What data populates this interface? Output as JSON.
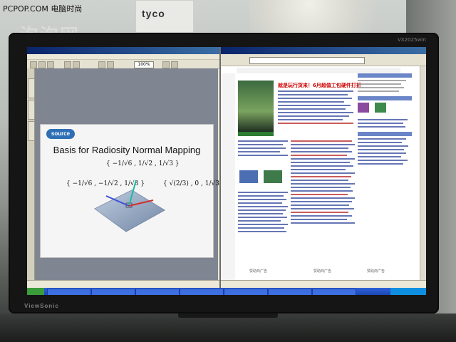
{
  "photo": {
    "site_mark": "PCPOP.COM 电脑时尚",
    "watermark": "泡泡网",
    "box_brand": "tyco"
  },
  "monitor": {
    "brand_bottom": "ViewSonic",
    "brand_top": "VX2025wm"
  },
  "pdf_window": {
    "zoom": "100%",
    "slide": {
      "logo": "source",
      "title": "Basis for Radiosity Normal Mapping",
      "formula_top": "{ −1/√6 , 1/√2 , 1/√3 }",
      "formula_left": "{ −1/√6 , −1/√2 , 1/√3 }",
      "formula_right": "{ √(2/3) , 0 , 1/√3 }"
    }
  },
  "browser_window": {
    "headline": "就是玩行货来！6月超值工包硬件打折",
    "ads": [
      "赞助商广告",
      "赞助商广告",
      "赞助商广告"
    ]
  },
  "colors": {
    "titlebar_left": "#0a246a",
    "titlebar_right": "#3a6ea5",
    "taskbar": "#2f62d9",
    "start_button": "#3b9c3b",
    "slide_logo": "#2e6fb6",
    "axis_teal": "#1abc9c",
    "axis_blue": "#3b4fd8",
    "axis_red": "#d0302f"
  }
}
